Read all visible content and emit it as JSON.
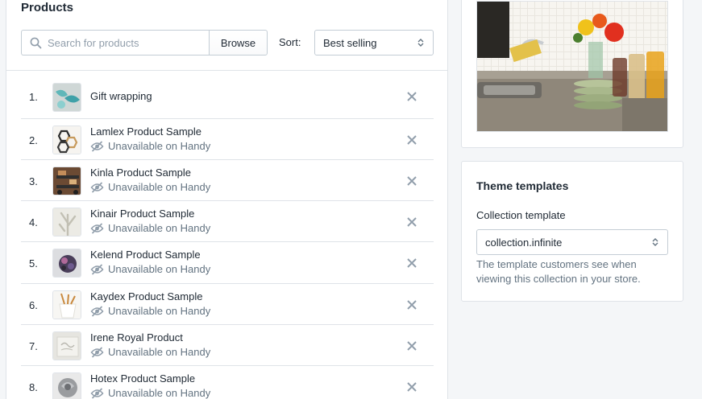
{
  "products": {
    "title": "Products",
    "search_placeholder": "Search for products",
    "browse_label": "Browse",
    "sort_label": "Sort:",
    "sort_value": "Best selling",
    "items": [
      {
        "index": "1.",
        "name": "Gift wrapping",
        "status": "",
        "thumb": "gift"
      },
      {
        "index": "2.",
        "name": "Lamlex Product Sample",
        "status": "Unavailable on Handy",
        "thumb": "hex"
      },
      {
        "index": "3.",
        "name": "Kinla Product Sample",
        "status": "Unavailable on Handy",
        "thumb": "cart"
      },
      {
        "index": "4.",
        "name": "Kinair Product Sample",
        "status": "Unavailable on Handy",
        "thumb": "branch"
      },
      {
        "index": "5.",
        "name": "Kelend Product Sample",
        "status": "Unavailable on Handy",
        "thumb": "flower"
      },
      {
        "index": "6.",
        "name": "Kaydex Product Sample",
        "status": "Unavailable on Handy",
        "thumb": "pot"
      },
      {
        "index": "7.",
        "name": "Irene Royal Product",
        "status": "Unavailable on Handy",
        "thumb": "card"
      },
      {
        "index": "8.",
        "name": "Hotex Product Sample",
        "status": "Unavailable on Handy",
        "thumb": "rose"
      }
    ]
  },
  "theme": {
    "title": "Theme templates",
    "template_label": "Collection template",
    "template_value": "collection.infinite",
    "help_text": "The template customers see when viewing this collection in your store."
  },
  "colors": {
    "text": "#212b36",
    "subdued": "#637381",
    "border": "#dfe3e8",
    "background": "#f4f6f8"
  }
}
